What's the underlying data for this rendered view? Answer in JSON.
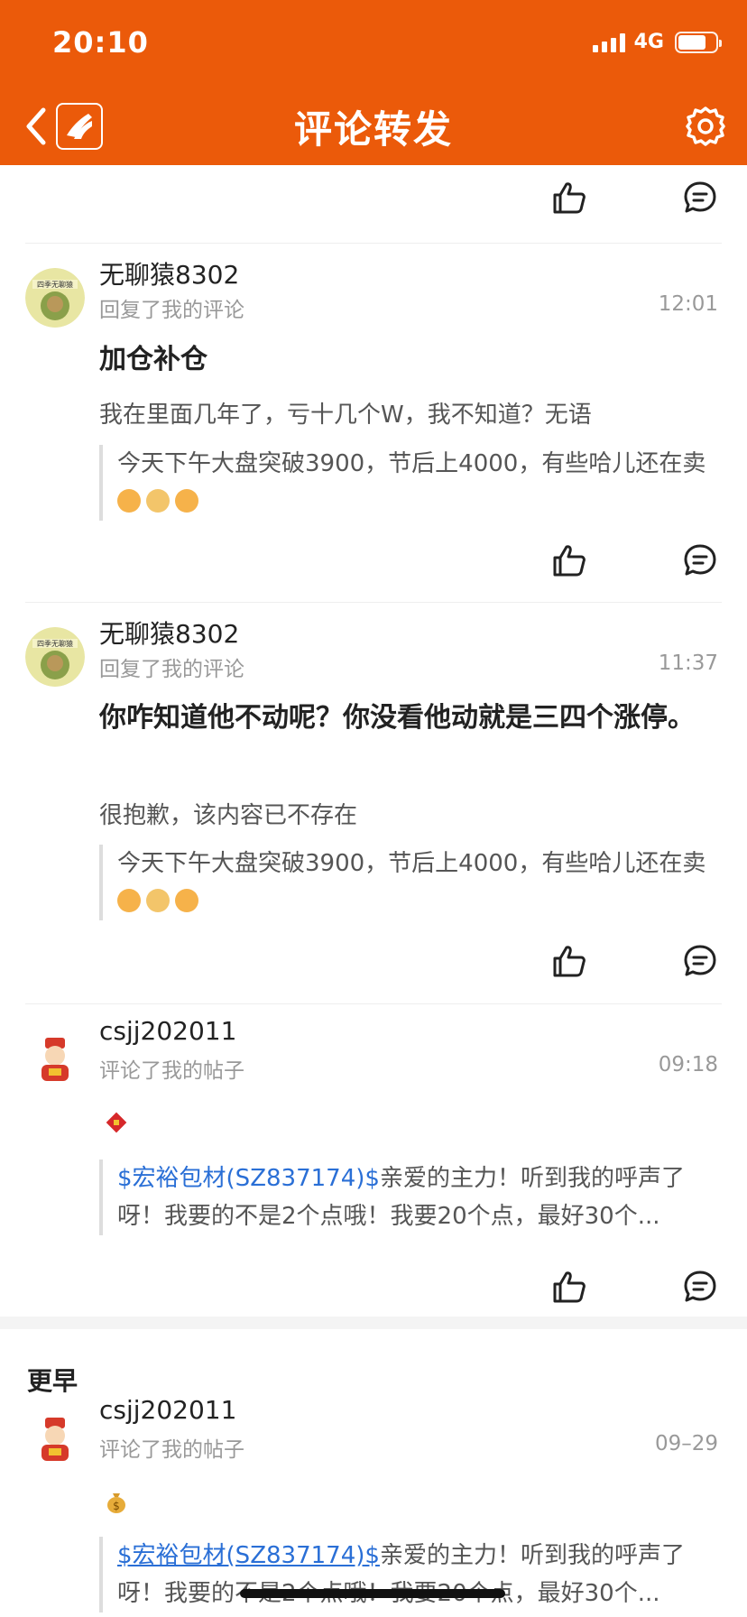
{
  "status_bar": {
    "time": "20:10",
    "network": "4G"
  },
  "nav": {
    "title": "评论转发"
  },
  "colors": {
    "brand": "#eb5a0a",
    "link": "#2a6fd6",
    "meta": "#999999"
  },
  "icons": {
    "back": "chevron-left-icon",
    "logo": "app-logo-icon",
    "settings": "gear-icon",
    "like": "thumbs-up-icon",
    "comment": "comment-bubble-icon"
  },
  "notifications": [
    {
      "username": "无聊猿8302",
      "action": "回复了我的评论",
      "time": "12:01",
      "reply": "加仓补仓",
      "context": "我在里面几年了，亏十几个W，我不知道？无语",
      "quote": "今天下午大盘突破3900，节后上4000，有些哈儿还在卖"
    },
    {
      "username": "无聊猿8302",
      "action": "回复了我的评论",
      "time": "11:37",
      "reply": "你咋知道他不动呢？你没看他动就是三四个涨停。",
      "context": "很抱歉，该内容已不存在",
      "quote": "今天下午大盘突破3900，节后上4000，有些哈儿还在卖"
    },
    {
      "username": "csjj202011",
      "action": "评论了我的帖子",
      "time": "09:18",
      "reply_emoji": "fu-emoji",
      "quote_stock": "$宏裕包材(SZ837174)$",
      "quote": "亲爱的主力！听到我的呼声了呀！我要的不是2个点哦！我要20个点，最好30个..."
    }
  ],
  "earlier": {
    "header": "更早",
    "items": [
      {
        "username": "csjj202011",
        "action": "评论了我的帖子",
        "time": "09–29",
        "reply_emoji": "money-bag-emoji",
        "quote_stock": "$宏裕包材(SZ837174)$",
        "quote": "亲爱的主力！听到我的呼声了呀！我要的不是2个点哦！我要20个点，最好30个..."
      }
    ]
  }
}
